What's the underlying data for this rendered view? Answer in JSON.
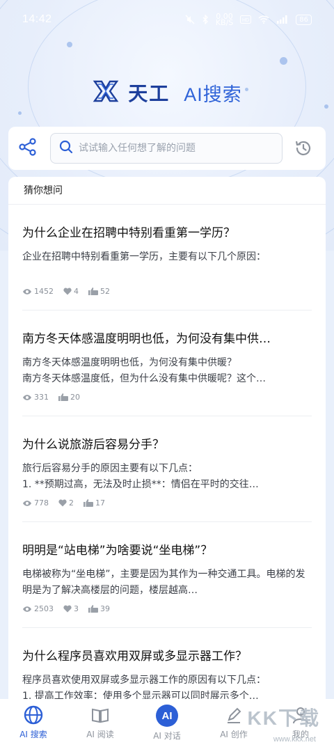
{
  "status_bar": {
    "time": "14:42",
    "speed_value": "0.00",
    "speed_unit": "KB/S",
    "battery": "86"
  },
  "brand": {
    "name": "天工",
    "subtitle": "AI搜索",
    "color": "#1d3f9c"
  },
  "search": {
    "placeholder": "试试输入任何想了解的问题"
  },
  "section": {
    "title": "猜你想问"
  },
  "questions": [
    {
      "title": "为什么企业在招聘中特别看重第一学历？",
      "body": "企业在招聘中特别看重第一学历，主要有以下几个原因：",
      "views": "1452",
      "likes": "4",
      "upvotes": "52"
    },
    {
      "title": "南方冬天体感温度明明也低，为何没有集中供…",
      "body": "南方冬天体感温度明明也低，为何没有集中供暖？\n南方冬天体感温度低，但为什么没有集中供暖呢？这个…",
      "views": "331",
      "upvotes": "20"
    },
    {
      "title": "为什么说旅游后容易分手？",
      "body": "旅行后容易分手的原因主要有以下几点：\n1. **预期过高，无法及时止损**：情侣在平时的交往…",
      "views": "778",
      "likes": "2",
      "upvotes": "17"
    },
    {
      "title": "明明是“站电梯”为啥要说“坐电梯”？",
      "body": "电梯被称为“坐电梯”，主要是因为其作为一种交通工具。电梯的发明是为了解决高楼层的问题，楼层越高…",
      "views": "2503",
      "likes": "3",
      "upvotes": "39"
    },
    {
      "title": "为什么程序员喜欢用双屏或多显示器工作？",
      "body": "程序员喜欢使用双屏或多显示器工作的原因有以下几点：\n1. 提高工作效率：使用多个显示器可以同时展示多个…",
      "views": "",
      "likes": "",
      "upvotes": ""
    }
  ],
  "tabs": [
    {
      "label": "AI 搜索",
      "icon": "globe-icon",
      "active": true
    },
    {
      "label": "AI 阅读",
      "icon": "book-icon",
      "active": false
    },
    {
      "label": "AI 对话",
      "icon": "ai-chat-icon",
      "badge": "AI",
      "active": false
    },
    {
      "label": "AI 创作",
      "icon": "pen-icon",
      "active": false
    },
    {
      "label": "我的",
      "icon": "user-icon",
      "active": false
    }
  ],
  "watermark": {
    "logo": "KK下载",
    "url": "www.kkx.net"
  },
  "colors": {
    "accent": "#2c5fd6",
    "background": "#e9f0fb"
  }
}
